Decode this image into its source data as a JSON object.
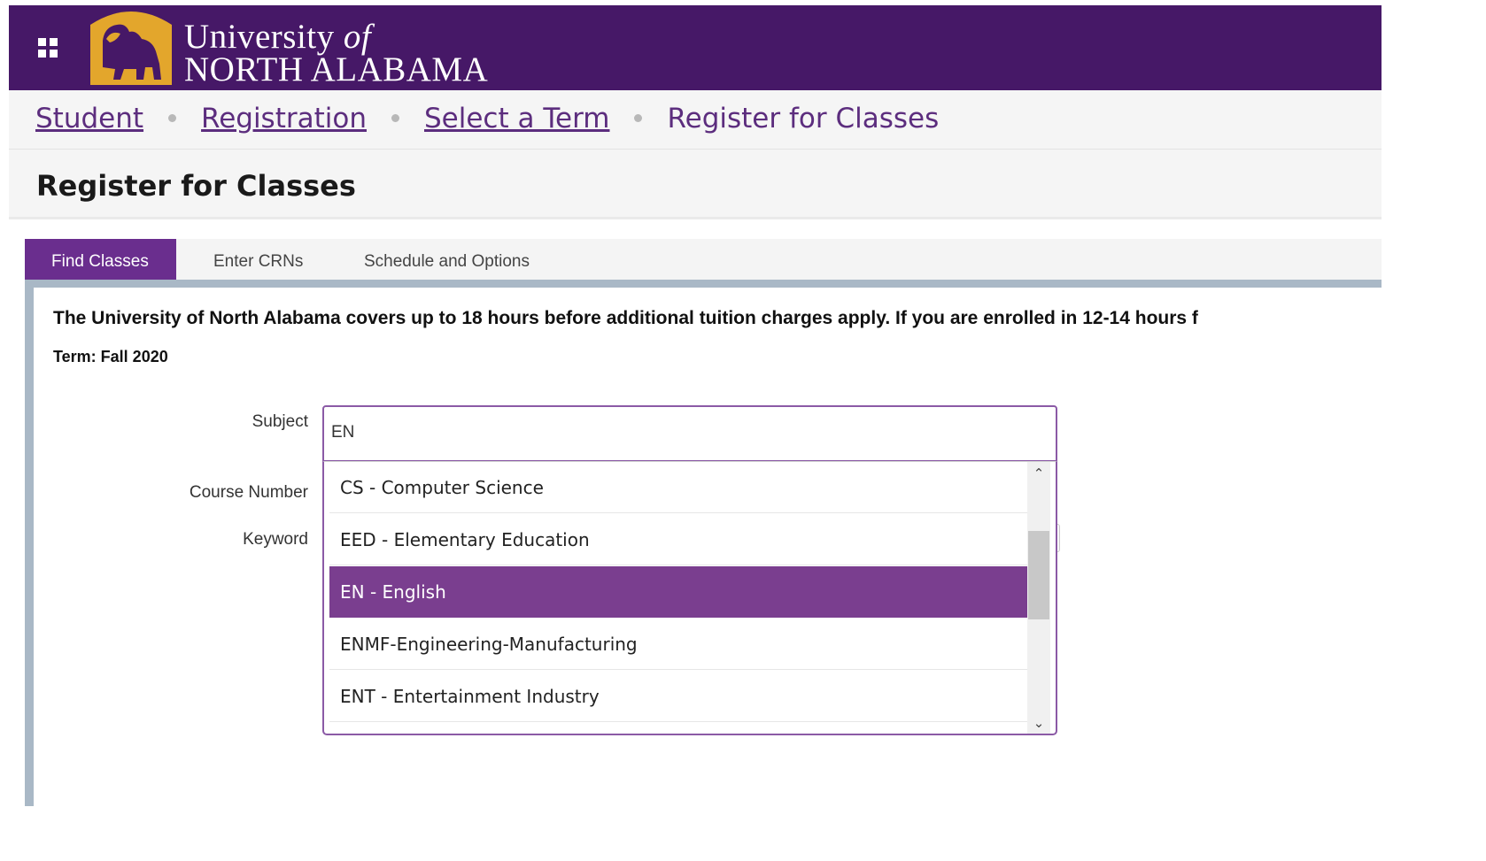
{
  "header": {
    "logo_line1": "University",
    "logo_line1_of": "of",
    "logo_line2": "NORTH ALABAMA",
    "brand_color": "#461867",
    "logo_color": "#e3a62c"
  },
  "breadcrumb": {
    "items": [
      "Student",
      "Registration",
      "Select a Term"
    ],
    "current": "Register for Classes"
  },
  "page": {
    "title": "Register for Classes"
  },
  "tabs": [
    {
      "label": "Find Classes",
      "active": true
    },
    {
      "label": "Enter CRNs",
      "active": false
    },
    {
      "label": "Schedule and Options",
      "active": false
    }
  ],
  "content": {
    "notice": "The University of North Alabama covers up to 18 hours before additional tuition charges apply. If you are enrolled in 12-14 hours f",
    "term": "Term: Fall 2020"
  },
  "form": {
    "subject_label": "Subject",
    "subject_value": "EN",
    "course_number_label": "Course Number",
    "keyword_label": "Keyword"
  },
  "dropdown": {
    "options": [
      "CS - Computer Science",
      "EED - Elementary Education",
      "EN - English",
      "ENMF-Engineering-Manufacturing",
      "ENT - Entertainment Industry"
    ],
    "selected": "EN - English"
  }
}
